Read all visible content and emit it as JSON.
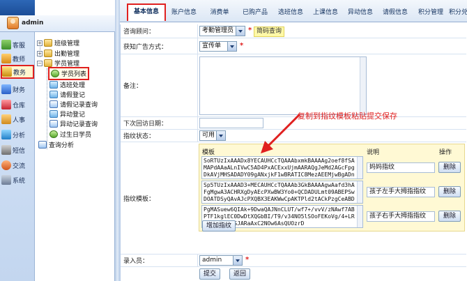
{
  "user": {
    "name": "admin"
  },
  "modules": [
    {
      "label": "客服",
      "icon": "headset-icon",
      "active": false
    },
    {
      "label": "教师",
      "icon": "teacher-icon",
      "active": false
    },
    {
      "label": "教务",
      "icon": "academic-icon",
      "active": true
    },
    {
      "label": "财务",
      "icon": "finance-icon",
      "active": false
    },
    {
      "label": "仓库",
      "icon": "warehouse-icon",
      "active": false
    },
    {
      "label": "人事",
      "icon": "hr-icon",
      "active": false
    },
    {
      "label": "分析",
      "icon": "chart-icon",
      "active": false
    },
    {
      "label": "短信",
      "icon": "sms-icon",
      "active": false
    },
    {
      "label": "交流",
      "icon": "chat-icon",
      "active": false
    },
    {
      "label": "系统",
      "icon": "system-icon",
      "active": false
    }
  ],
  "tree": {
    "class_mgmt": "班级管理",
    "attendance_mgmt": "出勤管理",
    "student_mgmt": "学员管理",
    "children": [
      "学员列表",
      "选班处理",
      "请假登记",
      "请假记录查询",
      "异动登记",
      "异动记录查询",
      "过生日学员"
    ],
    "query_analysis": "查询分析"
  },
  "tabs": [
    {
      "label": "基本信息",
      "active": true
    },
    {
      "label": "账户信息",
      "active": false
    },
    {
      "label": "消费单",
      "active": false
    },
    {
      "label": "已购产品",
      "active": false
    },
    {
      "label": "选班信息",
      "active": false
    },
    {
      "label": "上课信息",
      "active": false
    },
    {
      "label": "异动信息",
      "active": false
    },
    {
      "label": "请假信息",
      "active": false
    },
    {
      "label": "积分管理",
      "active": false
    },
    {
      "label": "积分兑换",
      "active": false
    }
  ],
  "form": {
    "consultant_label": "咨询顾问：",
    "consultant_value": "考勤管理员",
    "consultant_query": "简码查询",
    "ad_label": "获知广告方式：",
    "ad_value": "宣传单",
    "remark_label": "备注：",
    "next_visit_label": "下次回访日期：",
    "fp_status_label": "指纹状态：",
    "fp_status_value": "可用",
    "fp_template_label": "指纹模板：",
    "fp_col_template": "模板",
    "fp_col_desc": "说明",
    "fp_col_action": "操作",
    "fp_rows": [
      {
        "template": "SoRTUzIxAAADx8YECAUHCcTQAAAbxmkBAAAAg2oef8fSAMAPdAAaALnIVwC5AD4PxACExxUjmAARAQgJeMd2AGcFpgDkAVjMHSADADY09gANxjkF1wBRATIC8MezAEEMjwBgADnMxQCDAOPAgCqxz",
        "desc": "妈妈指纹"
      },
      {
        "template": "Sp5TUzIxAAAD3+MECAUHCcTQAAAb3GkBAAAAgwAafd3hAFgMgwA3ACHRXgDyAEcPXwBW3Yo0+QCDADULmt09ABEPSwDOATDSyQAvAJcPXQBX3EAKWwCpAKTPld2tACkPzgCeABDQtQAWATcPZAAb3L",
        "desc": "孩子左手大拇指指纹"
      },
      {
        "template": "PgMASuew6QIAk+9DwaQAJNnCLUT/wf7+/vvV/zNAwf7ABPTF1kglEC0DwDtXQGbBI/T9/v34NO5lSOoFEKoVg/4+LRF3IDeaBN9SJARaAxC2NOw6AsQUOzrD",
        "desc": "孩子右手大拇指指纹"
      }
    ],
    "delete_label": "删除",
    "add_fp_label": "增加指纹",
    "operator_label": "录入员：",
    "operator_value": "admin",
    "submit_label": "提交",
    "back_label": "返回"
  },
  "annotation": "复制到指纹模板粘贴提交保存",
  "colors": {
    "highlight": "#e0201f",
    "accent": "#2d67b6"
  }
}
